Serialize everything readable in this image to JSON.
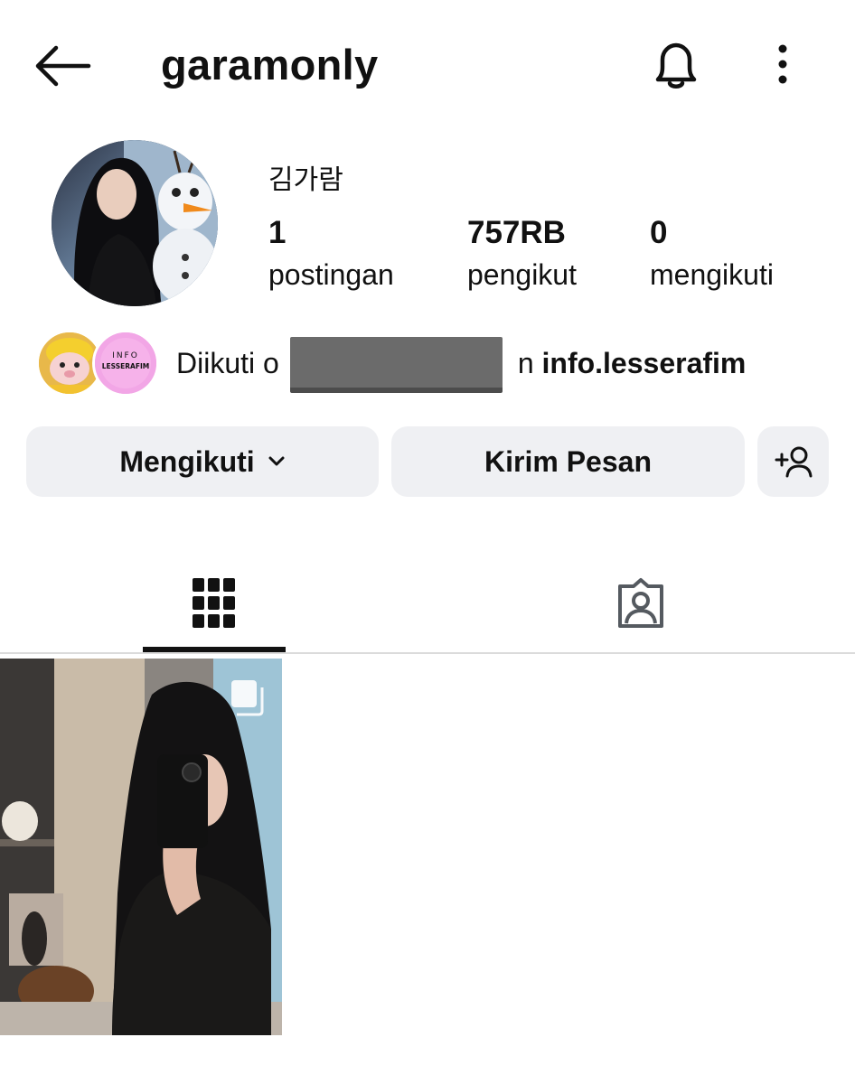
{
  "header": {
    "username": "garamonly",
    "back_icon": "arrow-left-icon",
    "bell_icon": "bell-icon",
    "more_icon": "more-vertical-icon"
  },
  "profile": {
    "display_name": "김가람",
    "stats": [
      {
        "value": "1",
        "label": "postingan"
      },
      {
        "value": "757RB",
        "label": "pengikut"
      },
      {
        "value": "0",
        "label": "mengikuti"
      }
    ],
    "followed_by": {
      "prefix": "Diikuti o",
      "suffix": "n ",
      "highlight": "info.lesserafim"
    },
    "mutual_avatar_2_text": [
      "INFO",
      "LESSERAFIM"
    ]
  },
  "actions": {
    "follow_label": "Mengikuti",
    "message_label": "Kirim Pesan",
    "add_user_icon": "add-user-icon"
  },
  "tabs": [
    {
      "name": "posts",
      "icon": "grid-icon",
      "active": true
    },
    {
      "name": "tagged",
      "icon": "tagged-person-icon",
      "active": false
    }
  ],
  "colors": {
    "button_bg": "#eff0f3",
    "text": "#111111",
    "divider": "#dbdbdb",
    "inactive_icon": "#555a60"
  }
}
